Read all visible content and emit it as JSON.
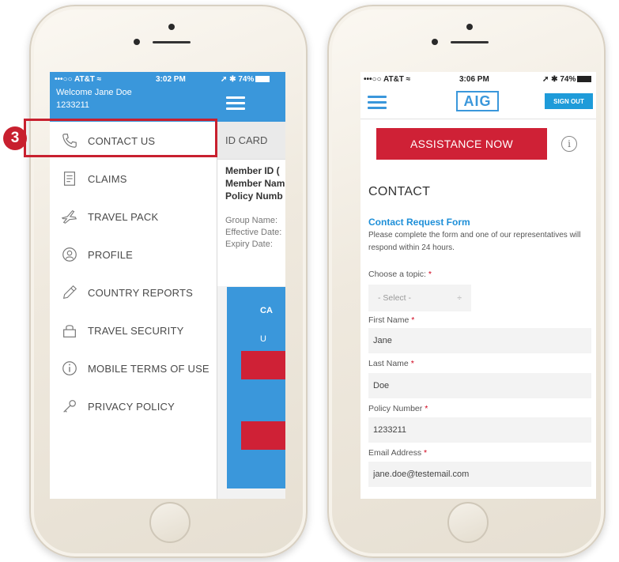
{
  "colors": {
    "accent_blue": "#3a97db",
    "accent_red": "#cf2136",
    "callout_red": "#c8202f",
    "link_blue": "#1e8fd8"
  },
  "callout": {
    "step_number": "3"
  },
  "left_phone": {
    "status": {
      "carrier": "•••○○ AT&T ≈",
      "time": "3:02 PM",
      "battery": "74%"
    },
    "user": {
      "welcome": "Welcome Jane Doe",
      "member_no": "1233211"
    },
    "menu": [
      {
        "label": "CONTACT US",
        "icon": "phone-icon"
      },
      {
        "label": "CLAIMS",
        "icon": "claims-icon"
      },
      {
        "label": "TRAVEL PACK",
        "icon": "airplane-icon"
      },
      {
        "label": "PROFILE",
        "icon": "profile-icon"
      },
      {
        "label": "COUNTRY REPORTS",
        "icon": "pencil-icon"
      },
      {
        "label": "TRAVEL SECURITY",
        "icon": "lock-icon"
      },
      {
        "label": "MOBILE TERMS OF USE",
        "icon": "info-icon"
      },
      {
        "label": "PRIVACY POLICY",
        "icon": "key-icon"
      }
    ],
    "background_page": {
      "tab": "ID CARD",
      "bold_lines": [
        "Member ID (",
        "Member Nam",
        "Policy Numb"
      ],
      "light_lines": [
        "Group Name:",
        "Effective Date:",
        "Expiry Date:"
      ],
      "card_text_1": "CA",
      "card_text_2": "U"
    }
  },
  "right_phone": {
    "status": {
      "carrier": "•••○○ AT&T ≈",
      "time": "3:06 PM",
      "battery": "74%"
    },
    "logo": "AIG",
    "sign_out": "SIGN OUT",
    "assistance_button": "ASSISTANCE NOW",
    "info_symbol": "i",
    "heading": "CONTACT",
    "form": {
      "title": "Contact Request Form",
      "description": "Please complete the form and one of our representatives will respond within 24 hours.",
      "required_mark": "*",
      "topic": {
        "label": "Choose a topic:",
        "value": "- Select -",
        "arrow": "÷"
      },
      "first_name": {
        "label": "First Name",
        "value": "Jane"
      },
      "last_name": {
        "label": "Last Name",
        "value": "Doe"
      },
      "policy_number": {
        "label": "Policy Number",
        "value": "1233211"
      },
      "email": {
        "label": "Email Address",
        "value": "jane.doe@testemail.com"
      }
    }
  }
}
